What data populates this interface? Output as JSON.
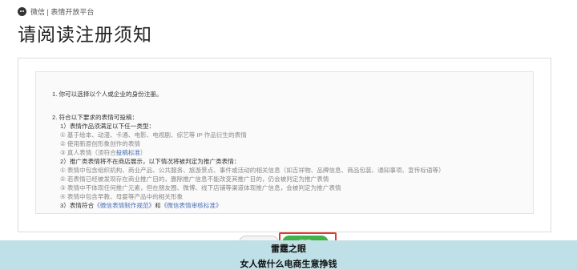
{
  "brand": {
    "name": "微信 | 表情开放平台"
  },
  "page_title": "请阅读注册须知",
  "lines": [
    {
      "text": "1. 你可以选择以个人或企业的身份注册。",
      "style": "dark"
    },
    {
      "text": "2. 符合以下要求的表情可投稿：",
      "style": "dark"
    },
    {
      "text": "1）表情作品须满足以下任一类型：",
      "style": "dark"
    },
    {
      "text": "① 基于绘本、动漫、卡通、电影、电视剧、综艺等 IP 作品衍生的表情",
      "style": "grey"
    },
    {
      "text": "② 使用新原创形象创作的表情",
      "style": "grey"
    },
    {
      "pre": "③ 真人表情（须符合",
      "link": "投稿标准",
      "post": "）",
      "style": "grey"
    },
    {
      "text": "2）推广类表情将不在商店展示，以下情况将被判定为推广类表情：",
      "style": "dark"
    },
    {
      "text": "① 表情中包含组织机构、商业产品、公共服务、旅游景点、事件或活动的相关信息（如吉祥物、品牌信息、商品包装、通知事项、宣传标语等）",
      "style": "grey"
    },
    {
      "text": "② 若表情已经被发现存在商业推广目的，删除推广信息不能改变其推广目的，仍会被判定为推广表情",
      "style": "grey"
    },
    {
      "text": "③ 表情中不体现任何推广元素，但在朋友圈、微博、线下店铺等渠道体现推广信息，会被判定为推广表情",
      "style": "grey"
    },
    {
      "text": "④ 表情中包含早教、母婴等产品中的相关形象",
      "style": "grey"
    },
    {
      "pre": "3）表情符合",
      "link": "《微信表情制作规范》",
      "mid": "和",
      "link2": "《微信表情审核标准》",
      "style": "dark"
    }
  ],
  "buttons": {
    "cancel": "取消",
    "agree": "同意"
  },
  "banner": {
    "line1": "雷霆之眼",
    "line2": "女人做什么电商生意挣钱"
  }
}
